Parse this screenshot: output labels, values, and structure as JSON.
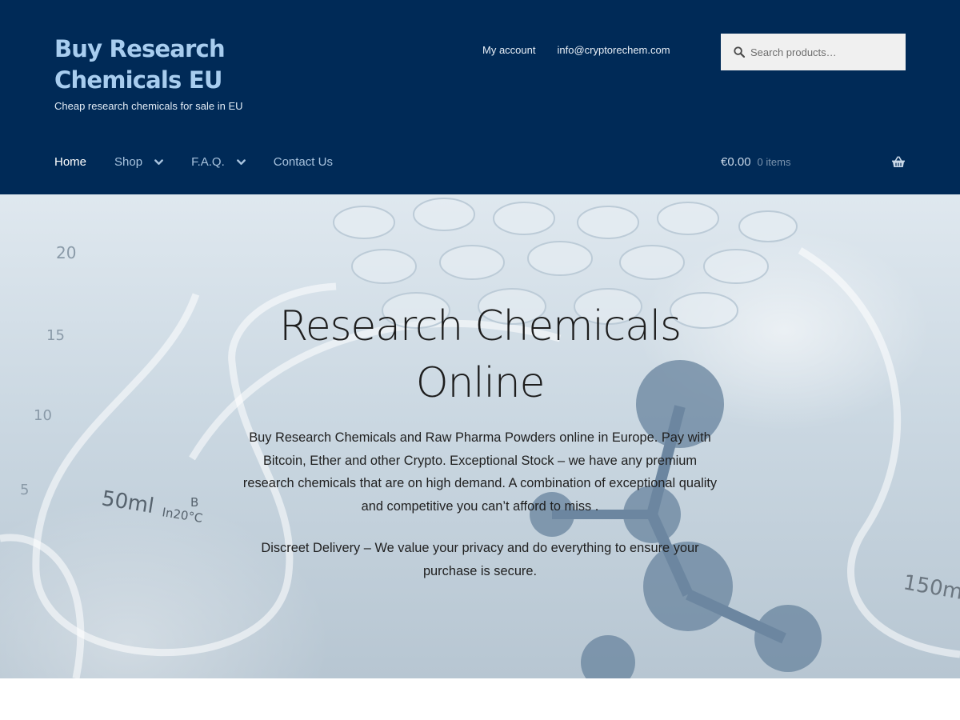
{
  "header": {
    "site_title": "Buy Research Chemicals EU",
    "tagline": "Cheap research chemicals for sale in EU",
    "secondary_nav": [
      "My account",
      "info@cryptorechem.com"
    ],
    "search_placeholder": "Search products…",
    "primary_nav": [
      {
        "label": "Home",
        "current": true,
        "has_dropdown": false
      },
      {
        "label": "Shop",
        "current": false,
        "has_dropdown": true
      },
      {
        "label": "F.A.Q.",
        "current": false,
        "has_dropdown": true
      },
      {
        "label": "Contact Us",
        "current": false,
        "has_dropdown": false
      }
    ],
    "cart": {
      "amount": "€0.00",
      "count": "0 items",
      "icon": "basket-icon"
    }
  },
  "hero": {
    "title": "Research Chemicals Online",
    "paragraphs": [
      "Buy Research Chemicals and Raw Pharma Powders online in Europe. Pay with Bitcoin, Ether and other Crypto. Exceptional Stock – we have any premium research chemicals that are on high demand. A combination of exceptional quality and competitive you can’t afford to miss .",
      "Discreet Delivery – We value your privacy and do everything to ensure your purchase is secure."
    ],
    "background_labels": [
      "20",
      "15",
      "10",
      "5",
      "50ml",
      "In20°C",
      "B",
      "150m"
    ]
  },
  "colors": {
    "header_bg": "#002a57",
    "site_title": "#a8cdef",
    "nav_link": "#a8c3de",
    "nav_current": "#ffffff"
  }
}
